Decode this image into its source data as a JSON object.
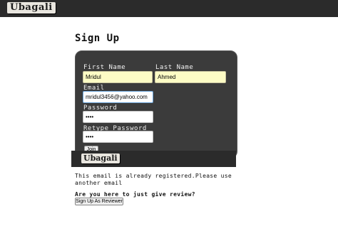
{
  "header": {
    "logo_text": "Ubagali"
  },
  "page_title": "Sign Up",
  "form": {
    "first_name_label": "First Name",
    "first_name_value": "Mridul",
    "last_name_label": "Last Name",
    "last_name_value": "Ahmed",
    "email_label": "Email",
    "email_value": "mridul3456@yahoo.com",
    "password_label": "Password",
    "password_value": "••••",
    "retype_label": "Retype Password",
    "retype_value": "••••",
    "join_label": "Join"
  },
  "footer_bar": {
    "logo_text": "Ubagali"
  },
  "message": "This email is already registered.Please use another email",
  "review": {
    "question": "Are you here to just give review?",
    "button_label": "Sign Up As Reviewer"
  },
  "colors": {
    "bar": "#2b2b2b",
    "panel": "#3b3b3b",
    "input_yellow": "#fdfcc5"
  }
}
